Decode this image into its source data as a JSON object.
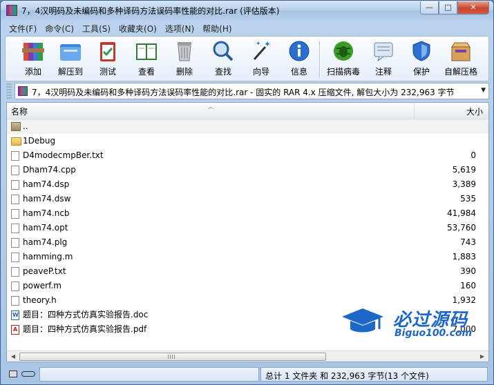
{
  "window": {
    "title": "7，4汉明码及未编码和多种译码方法误码率性能的对比.rar (评估版本)",
    "controls": {
      "minimize": "—",
      "maximize": "□",
      "close": "✕"
    }
  },
  "menu": [
    "文件(F)",
    "命令(C)",
    "工具(S)",
    "收藏夹(O)",
    "选项(N)",
    "帮助(H)"
  ],
  "toolbar": {
    "buttons": [
      {
        "label": "添加",
        "icon": "archive-add-icon"
      },
      {
        "label": "解压到",
        "icon": "extract-folder-icon"
      },
      {
        "label": "测试",
        "icon": "test-clipboard-icon"
      },
      {
        "label": "查看",
        "icon": "view-book-icon"
      },
      {
        "label": "删除",
        "icon": "trash-icon"
      },
      {
        "label": "查找",
        "icon": "magnifier-icon"
      },
      {
        "label": "向导",
        "icon": "wizard-wand-icon"
      },
      {
        "label": "信息",
        "icon": "info-icon"
      },
      {
        "label": "扫描病毒",
        "icon": "virus-scan-icon"
      },
      {
        "label": "注释",
        "icon": "comment-icon"
      },
      {
        "label": "保护",
        "icon": "shield-icon"
      },
      {
        "label": "自解压格",
        "icon": "sfx-box-icon"
      }
    ]
  },
  "pathbar": {
    "text": "7，4汉明码及未编码和多种译码方法误码率性能的对比.rar - 固实的 RAR 4.x 压缩文件, 解包大小为 232,963 字节"
  },
  "columns": {
    "name": "名称",
    "size": "大小"
  },
  "files": [
    {
      "name": "..",
      "size": "",
      "type": "up"
    },
    {
      "name": "1Debug",
      "size": "",
      "type": "folder"
    },
    {
      "name": "D4modecmpBer.txt",
      "size": "0",
      "type": "txt"
    },
    {
      "name": "Dham74.cpp",
      "size": "5,619",
      "type": "txt"
    },
    {
      "name": "ham74.dsp",
      "size": "3,389",
      "type": "txt"
    },
    {
      "name": "ham74.dsw",
      "size": "535",
      "type": "txt"
    },
    {
      "name": "ham74.ncb",
      "size": "41,984",
      "type": "txt"
    },
    {
      "name": "ham74.opt",
      "size": "53,760",
      "type": "txt"
    },
    {
      "name": "ham74.plg",
      "size": "743",
      "type": "txt"
    },
    {
      "name": "hamming.m",
      "size": "1,883",
      "type": "txt"
    },
    {
      "name": "peaveP.txt",
      "size": "390",
      "type": "txt"
    },
    {
      "name": "powerf.m",
      "size": "160",
      "type": "txt"
    },
    {
      "name": "theory.h",
      "size": "1,932",
      "type": "txt"
    },
    {
      "name": "题目：四种方式仿真实验报告.doc",
      "size": "",
      "type": "doc"
    },
    {
      "name": "题目：四种方式仿真实验报告.pdf",
      "size": "7,000",
      "type": "pdf"
    }
  ],
  "status": {
    "text": "总计 1 文件夹 和 232,963 字节(13 个文件)"
  },
  "watermark": {
    "title": "必过源码",
    "subtitle": "Biguo100.com"
  },
  "colors": {
    "accent": "#1d67c9",
    "titlebar": "#b7cfeb"
  }
}
